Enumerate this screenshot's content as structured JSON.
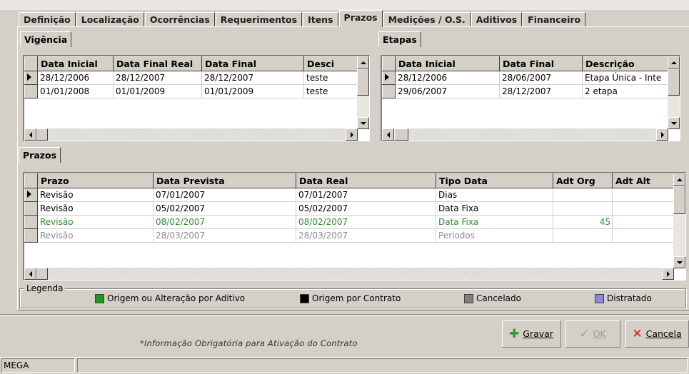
{
  "main_tabs": [
    {
      "label": "Definição",
      "active": false
    },
    {
      "label": "Localização",
      "active": false
    },
    {
      "label": "Ocorrências",
      "active": false
    },
    {
      "label": "Requerimentos",
      "active": false
    },
    {
      "label": "Itens",
      "active": false
    },
    {
      "label": "Prazos",
      "active": true
    },
    {
      "label": "Medições / O.S.",
      "active": false
    },
    {
      "label": "Aditivos",
      "active": false
    },
    {
      "label": "Financeiro",
      "active": false
    }
  ],
  "vigencia": {
    "tab_label": "Vigência",
    "columns": [
      "Data Inicial",
      "Data Final Real",
      "Data Final",
      "Desci"
    ],
    "rows": [
      [
        "28/12/2006",
        "28/12/2007",
        "28/12/2007",
        "teste"
      ],
      [
        "01/01/2008",
        "01/01/2009",
        "01/01/2009",
        "teste"
      ]
    ]
  },
  "etapas": {
    "tab_label": "Etapas",
    "columns": [
      "Data Inicial",
      "Data Final",
      "Descrição"
    ],
    "rows": [
      [
        "28/12/2006",
        "28/06/2007",
        "Etapa Única - Inte"
      ],
      [
        "29/06/2007",
        "28/12/2007",
        "2 etapa"
      ]
    ]
  },
  "prazos": {
    "tab_label": "Prazos",
    "columns": [
      "Prazo",
      "Data Prevista",
      "Data Real",
      "Tipo Data",
      "Adt Org",
      "Adt Alt"
    ],
    "rows": [
      [
        "Revisão",
        "07/01/2007",
        "07/01/2007",
        "Dias",
        "",
        ""
      ],
      [
        "Revisão",
        "05/02/2007",
        "05/02/2007",
        "Data Fixa",
        "",
        ""
      ],
      [
        "Revisão",
        "08/02/2007",
        "08/02/2007",
        "Data Fixa",
        "45",
        ""
      ],
      [
        "Revisão",
        "28/03/2007",
        "28/03/2007",
        "Periodos",
        "",
        ""
      ]
    ],
    "row_colors": [
      "normal",
      "normal",
      "green",
      "gray"
    ]
  },
  "legend": {
    "title": "Legenda",
    "items": [
      {
        "label": "Origem ou Alteração por Aditivo",
        "color": "#1f9a1f"
      },
      {
        "label": "Origem por Contrato",
        "color": "#000000"
      },
      {
        "label": "Cancelado",
        "color": "#808080"
      },
      {
        "label": "Distratado",
        "color": "#8a8ad6"
      }
    ]
  },
  "footer": {
    "note": "*Informação Obrigatória para Ativação do Contrato",
    "save_label": "Gravar",
    "ok_label": "OK",
    "cancel_label": "Cancela"
  },
  "status": {
    "panel1": "MEGA",
    "panel2": ""
  }
}
